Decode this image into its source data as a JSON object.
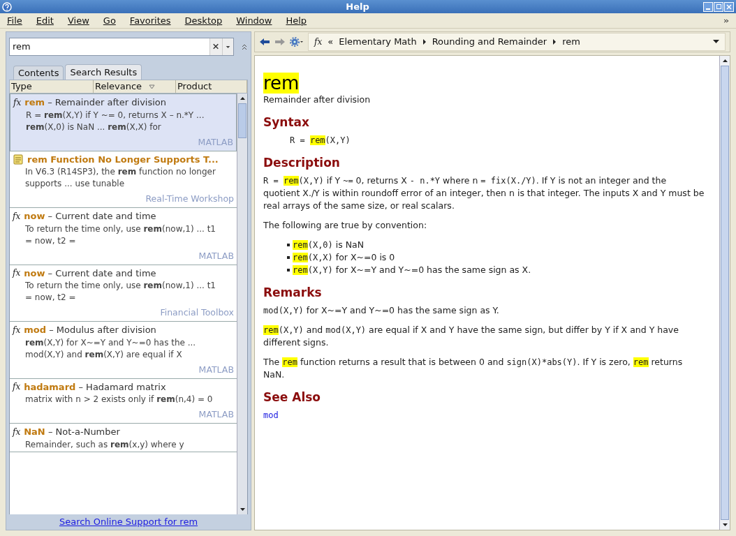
{
  "window": {
    "title": "Help"
  },
  "menu": [
    "File",
    "Edit",
    "View",
    "Go",
    "Favorites",
    "Desktop",
    "Window",
    "Help"
  ],
  "search": {
    "value": "rem"
  },
  "tabs": [
    {
      "label": "Contents",
      "selected": false
    },
    {
      "label": "Search Results",
      "selected": true
    }
  ],
  "columns": [
    "Type",
    "Relevance",
    "Product"
  ],
  "results": [
    {
      "kind": "function",
      "badge": "fx",
      "selected": true,
      "name": "rem",
      "title": " – Remainder after division",
      "snippet": "R = **rem**(X,Y) if Y ~= 0, returns X – n.*Y ... **rem**(X,0) is NaN ... **rem**(X,X) for",
      "product": "MATLAB"
    },
    {
      "kind": "page",
      "selected": false,
      "name": "rem Function No Longer Supports T...",
      "snippet": "In V6.3 (R14SP3), the **rem** function no longer supports ... use tunable",
      "product": "Real-Time Workshop"
    },
    {
      "kind": "function",
      "badge": "fx",
      "selected": false,
      "name": "now",
      "title": " – Current date and time",
      "snippet": "To return the time only, use **rem**(now,1) ... t1 = now, t2 =",
      "product": "MATLAB"
    },
    {
      "kind": "function",
      "badge": "fx",
      "selected": false,
      "name": "now",
      "title": " – Current date and time",
      "snippet": "To return the time only, use **rem**(now,1) ... t1 = now, t2 =",
      "product": "Financial Toolbox"
    },
    {
      "kind": "function",
      "badge": "fx",
      "selected": false,
      "name": "mod",
      "title": " – Modulus after division",
      "snippet": "**rem**(X,Y) for X~=Y and Y~=0 has the ... mod(X,Y) and **rem**(X,Y) are equal if X",
      "product": "MATLAB"
    },
    {
      "kind": "function",
      "badge": "fx",
      "selected": false,
      "name": "hadamard",
      "title": " – Hadamard matrix",
      "snippet": "matrix with n > 2 exists only if **rem**(n,4) = 0",
      "product": "MATLAB"
    },
    {
      "kind": "function",
      "badge": "fx",
      "selected": false,
      "name": "NaN",
      "title": " – Not-a-Number",
      "snippet": "Remainder, such as **rem**(x,y) where y"
    }
  ],
  "online_link": "Search Online Support for rem",
  "breadcrumb_icon": "fx",
  "breadcrumb_back": "«",
  "breadcrumb": [
    "Elementary Math",
    "Rounding and Remainder",
    "rem"
  ],
  "page": {
    "title": "rem",
    "subtitle": "Remainder after division",
    "sections": [
      {
        "heading": "Syntax",
        "blocks": [
          {
            "kind": "syntax",
            "segments": [
              {
                "text": "R = ",
                "kind": "code"
              },
              {
                "text": "rem",
                "kind": "highlight"
              },
              {
                "text": "(X,Y)",
                "kind": "code"
              }
            ]
          }
        ]
      },
      {
        "heading": "Description",
        "blocks": [
          {
            "kind": "paragraph",
            "segments": [
              {
                "text": "R = ",
                "kind": "code"
              },
              {
                "text": "rem",
                "kind": "highlight"
              },
              {
                "text": "(X,Y)",
                "kind": "code"
              },
              {
                "text": " if Y ",
                "kind": "text"
              },
              {
                "text": "~=",
                "kind": "code"
              },
              {
                "text": " 0, returns X ",
                "kind": "text"
              },
              {
                "text": "- n.*Y",
                "kind": "code"
              },
              {
                "text": " where n ",
                "kind": "text"
              },
              {
                "text": "= fix(X./Y)",
                "kind": "code"
              },
              {
                "text": ". If Y is not an integer and the quotient X./Y is within roundoff error of an integer, then n is that integer. The inputs X and Y must be real arrays of the same size, or real scalars.",
                "kind": "text"
              }
            ]
          },
          {
            "kind": "paragraph",
            "segments": [
              {
                "text": "The following are true by convention:",
                "kind": "text"
              }
            ]
          },
          {
            "kind": "bullets",
            "items": [
              [
                {
                  "text": "rem",
                  "kind": "highlight"
                },
                {
                  "text": "(X,0)",
                  "kind": "code"
                },
                {
                  "text": " is NaN",
                  "kind": "text"
                }
              ],
              [
                {
                  "text": "rem",
                  "kind": "highlight"
                },
                {
                  "text": "(X,X)",
                  "kind": "code"
                },
                {
                  "text": " for X~=0 is 0",
                  "kind": "text"
                }
              ],
              [
                {
                  "text": "rem",
                  "kind": "highlight"
                },
                {
                  "text": "(X,Y)",
                  "kind": "code"
                },
                {
                  "text": " for X~=Y and Y~=0 has the same sign as X.",
                  "kind": "text"
                }
              ]
            ]
          }
        ]
      },
      {
        "heading": "Remarks",
        "blocks": [
          {
            "kind": "paragraph",
            "segments": [
              {
                "text": "mod(X,Y)",
                "kind": "code"
              },
              {
                "text": " for X~=Y and Y~=0 has the same sign as Y.",
                "kind": "text"
              }
            ]
          },
          {
            "kind": "paragraph",
            "segments": [
              {
                "text": "rem",
                "kind": "highlight"
              },
              {
                "text": "(X,Y)",
                "kind": "code"
              },
              {
                "text": " and ",
                "kind": "text"
              },
              {
                "text": "mod(X,Y)",
                "kind": "code"
              },
              {
                "text": " are equal if X and Y have the same sign, but differ by Y if X and Y have different signs.",
                "kind": "text"
              }
            ]
          },
          {
            "kind": "paragraph",
            "segments": [
              {
                "text": "The ",
                "kind": "text"
              },
              {
                "text": "rem",
                "kind": "highlight"
              },
              {
                "text": " function returns a result that is between 0 and ",
                "kind": "text"
              },
              {
                "text": "sign(X)*abs(Y)",
                "kind": "code"
              },
              {
                "text": ". If Y is zero, ",
                "kind": "text"
              },
              {
                "text": "rem",
                "kind": "highlight"
              },
              {
                "text": " returns NaN.",
                "kind": "text"
              }
            ]
          }
        ]
      },
      {
        "heading": "See Also",
        "blocks": [
          {
            "kind": "link",
            "segments": [
              {
                "text": "mod",
                "kind": "code"
              }
            ]
          }
        ]
      }
    ]
  }
}
